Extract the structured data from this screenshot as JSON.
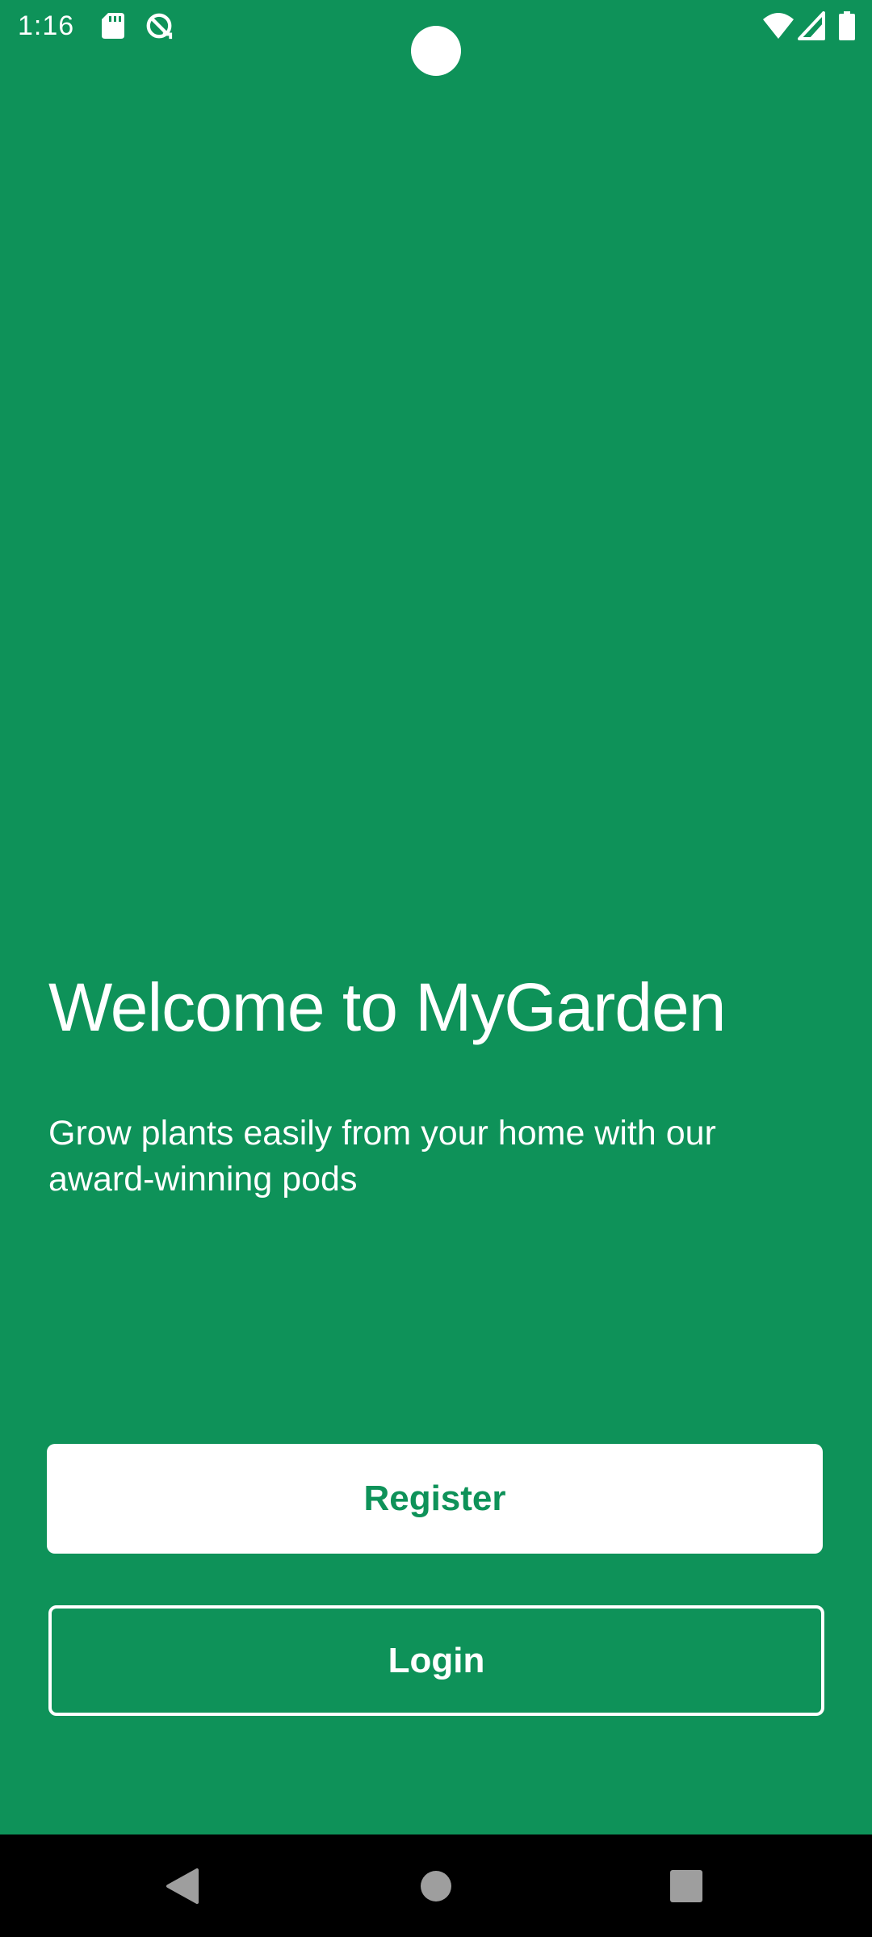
{
  "status_bar": {
    "time": "1:16",
    "icons": [
      "sd-card-icon",
      "sync-icon",
      "wifi-icon",
      "cell-signal-icon",
      "battery-icon"
    ]
  },
  "main": {
    "title": "Welcome to MyGarden",
    "subtitle": "Grow plants easily from your home with our award-winning pods",
    "register_label": "Register",
    "login_label": "Login"
  },
  "nav_bar": {
    "icons": [
      "back-icon",
      "home-icon",
      "recents-icon"
    ]
  },
  "colors": {
    "background": "#0e9259",
    "text": "#ffffff",
    "nav_background": "#000000"
  }
}
